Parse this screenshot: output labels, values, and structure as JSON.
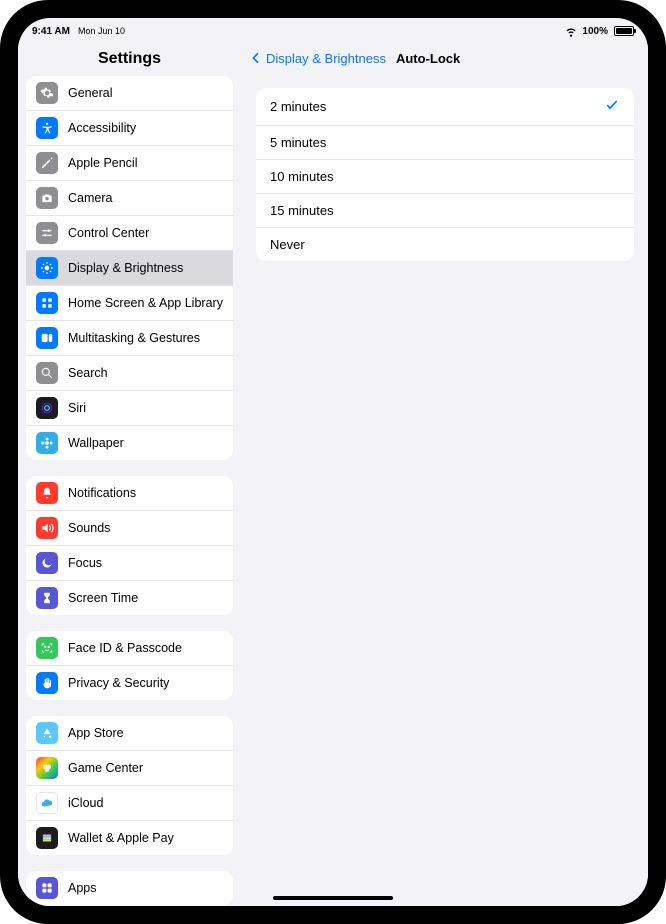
{
  "statusbar": {
    "time": "9:41 AM",
    "date": "Mon Jun 10",
    "battery_pct": "100%"
  },
  "sidebar": {
    "title": "Settings",
    "groups": [
      {
        "items": [
          {
            "id": "general",
            "label": "General"
          },
          {
            "id": "accessibility",
            "label": "Accessibility"
          },
          {
            "id": "apple-pencil",
            "label": "Apple Pencil"
          },
          {
            "id": "camera",
            "label": "Camera"
          },
          {
            "id": "control-center",
            "label": "Control Center"
          },
          {
            "id": "display-brightness",
            "label": "Display & Brightness",
            "selected": true
          },
          {
            "id": "home-screen",
            "label": "Home Screen & App Library"
          },
          {
            "id": "multitasking",
            "label": "Multitasking & Gestures"
          },
          {
            "id": "search",
            "label": "Search"
          },
          {
            "id": "siri",
            "label": "Siri"
          },
          {
            "id": "wallpaper",
            "label": "Wallpaper"
          }
        ]
      },
      {
        "items": [
          {
            "id": "notifications",
            "label": "Notifications"
          },
          {
            "id": "sounds",
            "label": "Sounds"
          },
          {
            "id": "focus",
            "label": "Focus"
          },
          {
            "id": "screen-time",
            "label": "Screen Time"
          }
        ]
      },
      {
        "items": [
          {
            "id": "faceid",
            "label": "Face ID & Passcode"
          },
          {
            "id": "privacy",
            "label": "Privacy & Security"
          }
        ]
      },
      {
        "items": [
          {
            "id": "app-store",
            "label": "App Store"
          },
          {
            "id": "game-center",
            "label": "Game Center"
          },
          {
            "id": "icloud",
            "label": "iCloud"
          },
          {
            "id": "wallet",
            "label": "Wallet & Apple Pay"
          }
        ]
      },
      {
        "items": [
          {
            "id": "apps",
            "label": "Apps"
          }
        ]
      }
    ]
  },
  "detail": {
    "back_label": "Display & Brightness",
    "title": "Auto-Lock",
    "options": [
      {
        "label": "2 minutes",
        "selected": true
      },
      {
        "label": "5 minutes",
        "selected": false
      },
      {
        "label": "10 minutes",
        "selected": false
      },
      {
        "label": "15 minutes",
        "selected": false
      },
      {
        "label": "Never",
        "selected": false
      }
    ]
  }
}
